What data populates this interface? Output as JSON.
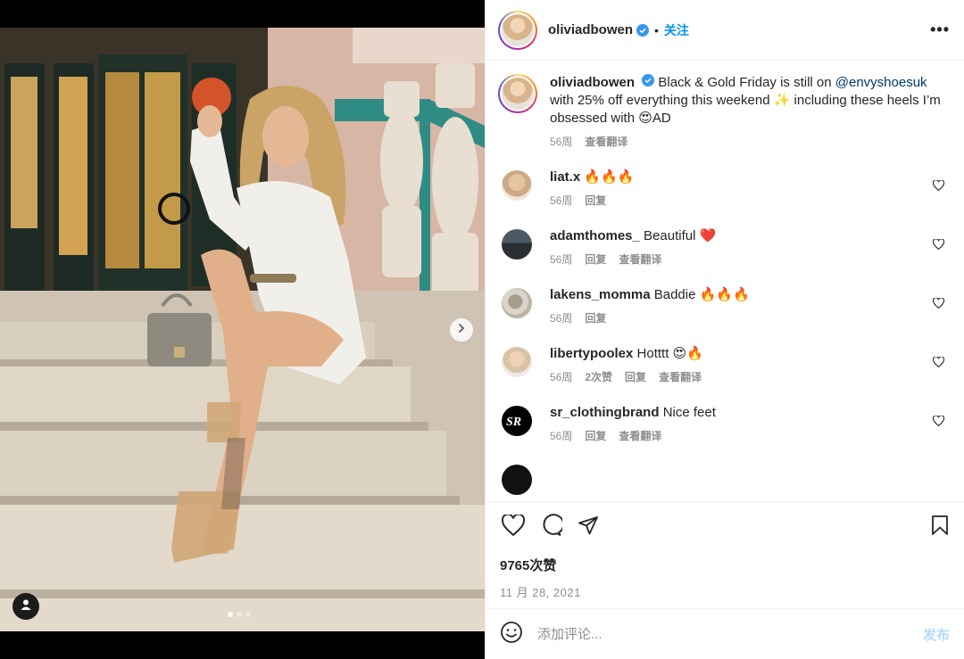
{
  "header": {
    "username": "oliviadbowen",
    "separator": "•",
    "follow_label": "关注",
    "more_label": "•••"
  },
  "caption": {
    "username": "oliviadbowen",
    "text_before": "Black & Gold Friday is still on ",
    "mention": "@envyshoesuk",
    "text_after": " with 25% off everything this weekend ✨ including these heels I’m obsessed with 😍AD",
    "time": "56周",
    "translate": "查看翻译"
  },
  "comments": [
    {
      "username": "liat.x",
      "text": "🔥🔥🔥",
      "time": "56周",
      "actions": [
        "回复"
      ]
    },
    {
      "username": "adamthomes_",
      "text": "Beautiful ❤️",
      "time": "56周",
      "actions": [
        "回复",
        "查看翻译"
      ]
    },
    {
      "username": "lakens_momma",
      "text": "Baddie 🔥🔥🔥",
      "time": "56周",
      "actions": [
        "回复"
      ]
    },
    {
      "username": "libertypoolex",
      "text": "Hotttt 😍🔥",
      "time": "56周",
      "actions": [
        "2次赞",
        "回复",
        "查看翻译"
      ]
    },
    {
      "username": "sr_clothingbrand",
      "text": "Nice feet",
      "time": "56周",
      "actions": [
        "回复",
        "查看翻译"
      ]
    }
  ],
  "stats": {
    "likes": "9765次赞",
    "date": "11 月 28, 2021"
  },
  "composer": {
    "placeholder": "添加评论...",
    "post_label": "发布"
  },
  "carousel": {
    "slide_count": 3,
    "active_index": 0
  },
  "colors": {
    "accent": "#0095f6",
    "mention": "#00376b",
    "muted": "#8e8e8e",
    "verified": "#3897f0"
  },
  "icons": [
    "like-icon",
    "comment-icon",
    "share-icon",
    "save-icon",
    "emoji-icon",
    "chevron-right-icon",
    "user-tag-icon",
    "verified-badge-icon",
    "more-icon"
  ]
}
